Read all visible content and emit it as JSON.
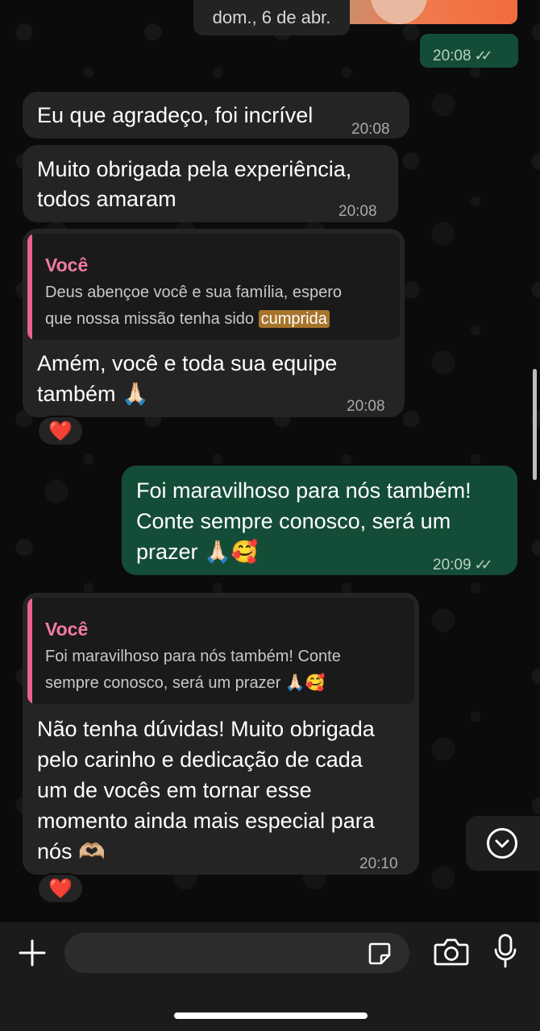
{
  "date_chip": "dom., 6 de abr.",
  "image_message": {
    "time": "20:08",
    "ticks": "✓✓"
  },
  "messages": [
    {
      "text": "Eu que agradeço, foi incrível",
      "time": "20:08"
    },
    {
      "text_lines": [
        "Muito obrigada pela experiência,",
        "todos amaram"
      ],
      "time": "20:08"
    },
    {
      "quote_author": "Você",
      "quote_lines": [
        "Deus abençoe você e sua família, espero",
        "que nossa missão tenha sido "
      ],
      "quote_highlight": "cumprida",
      "text_lines": [
        "Amém, você e toda sua equipe",
        "também 🙏🏻"
      ],
      "time": "20:08",
      "reaction": "❤️"
    },
    {
      "text_lines": [
        "Foi maravilhoso para nós também!",
        "Conte sempre conosco, será um",
        "prazer 🙏🏻🥰"
      ],
      "time": "20:09",
      "ticks": "✓✓"
    },
    {
      "quote_author": "Você",
      "quote_lines": [
        "Foi maravilhoso para nós também! Conte",
        "sempre conosco, será um prazer 🙏🏻🥰"
      ],
      "text_lines": [
        "Não tenha dúvidas! Muito obrigada",
        "pelo carinho e dedicação de cada",
        "um de vocês em tornar esse",
        "momento ainda mais especial para",
        "nós 🫶🏼"
      ],
      "time": "20:10",
      "reaction": "❤️"
    }
  ],
  "composer": {
    "input_placeholder": "",
    "icons": [
      "plus-icon",
      "sticker-icon",
      "camera-icon",
      "microphone-icon"
    ]
  },
  "scroll_button_icon": "chevron-down-icon",
  "colors": {
    "incoming_bubble": "#242424",
    "outgoing_bubble": "#144d37",
    "quote_accent": "#e9638f",
    "highlight": "#a7742b",
    "background": "#0b0b0b"
  }
}
